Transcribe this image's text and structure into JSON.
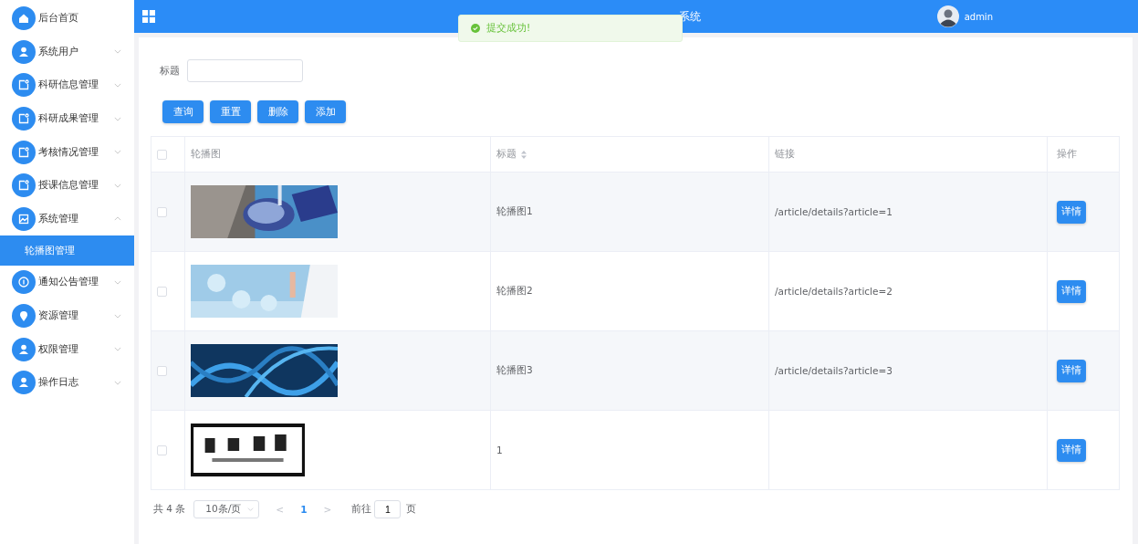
{
  "sidebar": {
    "items": [
      {
        "label": "后台首页",
        "kind": "link"
      },
      {
        "label": "系统用户",
        "kind": "menu",
        "expanded": false
      },
      {
        "label": "科研信息管理",
        "kind": "menu",
        "expanded": false
      },
      {
        "label": "科研成果管理",
        "kind": "menu",
        "expanded": false
      },
      {
        "label": "考核情况管理",
        "kind": "menu",
        "expanded": false
      },
      {
        "label": "授课信息管理",
        "kind": "menu",
        "expanded": false
      },
      {
        "label": "系统管理",
        "kind": "menu",
        "expanded": true,
        "children": [
          {
            "label": "轮播图管理",
            "selected": true
          }
        ]
      },
      {
        "label": "通知公告管理",
        "kind": "menu",
        "expanded": false
      },
      {
        "label": "资源管理",
        "kind": "menu",
        "expanded": false
      },
      {
        "label": "权限管理",
        "kind": "menu",
        "expanded": false
      },
      {
        "label": "操作日志",
        "kind": "menu",
        "expanded": false
      }
    ]
  },
  "header": {
    "title_visible": "系统",
    "user": "admin"
  },
  "toast": {
    "message": "提交成功!"
  },
  "search": {
    "label": "标题"
  },
  "buttons": [
    "查询",
    "重置",
    "删除",
    "添加"
  ],
  "table": {
    "select_all_checked": false,
    "columns": [
      "轮播图",
      "标题",
      "链接",
      "操作"
    ],
    "rows": [
      {
        "checked": false,
        "title": "轮播图1",
        "link": "/article/details?article=1",
        "action": "详情"
      },
      {
        "checked": false,
        "title": "轮播图2",
        "link": "/article/details?article=2",
        "action": "详情"
      },
      {
        "checked": false,
        "title": "轮播图3",
        "link": "/article/details?article=3",
        "action": "详情"
      },
      {
        "checked": false,
        "title": "1",
        "action": "详情"
      }
    ]
  },
  "pagination": {
    "total": "共 4 条",
    "page_size": "10条/页",
    "prev": "<",
    "pages": [
      {
        "label": "1",
        "selected": true
      }
    ],
    "next": ">",
    "goto_label": "前往",
    "goto_value": "1",
    "goto_suffix": "页"
  }
}
